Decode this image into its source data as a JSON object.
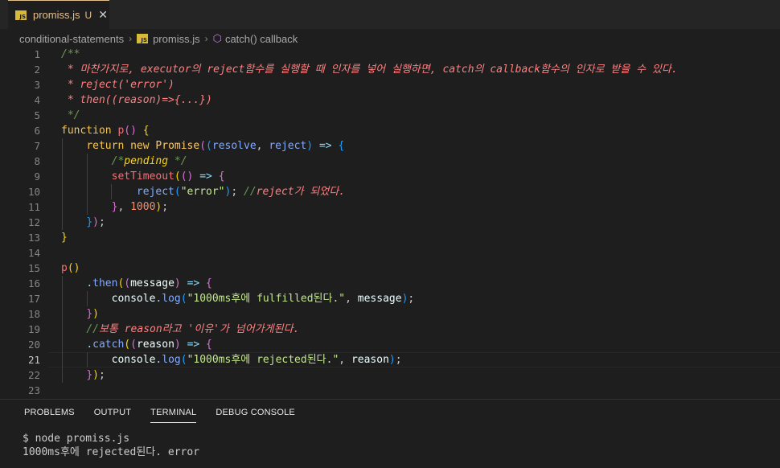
{
  "tab": {
    "badge": "JS",
    "filename": "promiss.js",
    "status": "U",
    "close_glyph": "✕"
  },
  "breadcrumb": {
    "folder": "conditional-statements",
    "file_badge": "JS",
    "file": "promiss.js",
    "symbol": "catch() callback",
    "sep": "›",
    "symbol_icon": "cube-icon"
  },
  "editor": {
    "line_numbers": [
      "1",
      "2",
      "3",
      "4",
      "5",
      "6",
      "7",
      "8",
      "9",
      "10",
      "11",
      "12",
      "13",
      "14",
      "15",
      "16",
      "17",
      "18",
      "19",
      "20",
      "21",
      "22",
      "23"
    ],
    "current_line": "21"
  },
  "panel": {
    "tabs": [
      "PROBLEMS",
      "OUTPUT",
      "TERMINAL",
      "DEBUG CONSOLE"
    ],
    "active_tab": "TERMINAL",
    "terminal_lines": [
      "$ node promiss.js",
      "1000ms후에 rejected된다. error"
    ]
  },
  "colors": {
    "background": "#1e1e1e",
    "tab_modified": "#e2c08d",
    "comment": "#6a9955",
    "keyword": "#f8c555"
  }
}
